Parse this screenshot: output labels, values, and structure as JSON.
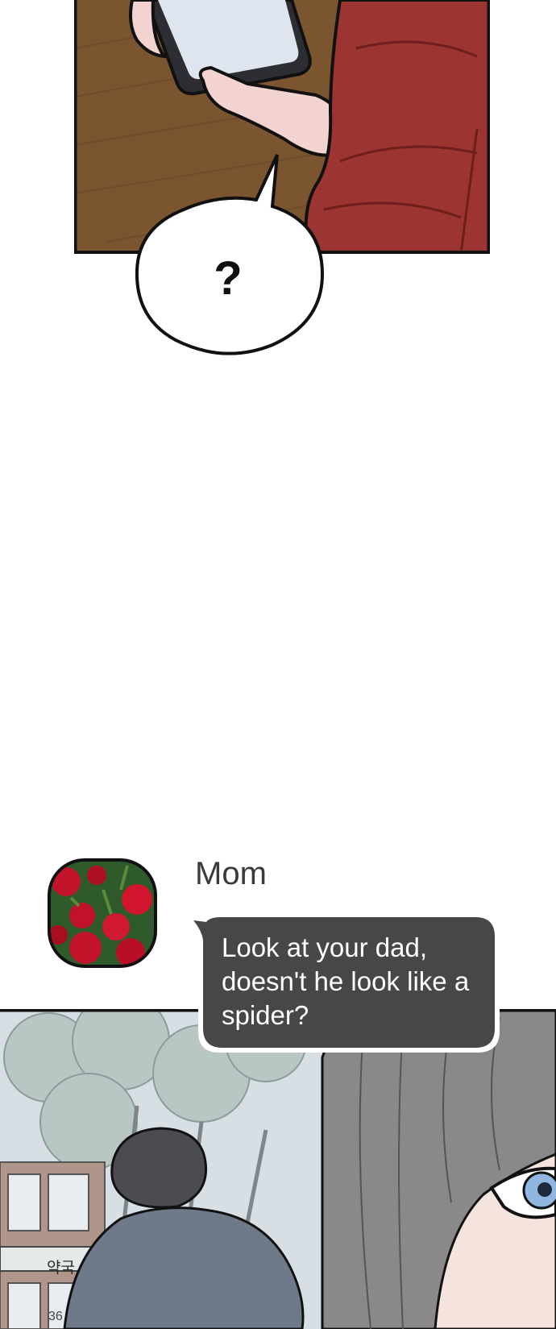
{
  "speech_bubble": {
    "text": "?"
  },
  "chat": {
    "sender": "Mom",
    "message": "Look at your dad, doesn't he look like a spider?"
  },
  "background": {
    "sign_text": "약국",
    "number_text": "36"
  },
  "colors": {
    "message_bubble": "#474747",
    "message_text": "#ffffff",
    "hoodie_red": "#9c3431",
    "floor_wood": "#7a5530",
    "panel_border": "#111111",
    "sky_wash": "#d7dfe4",
    "hair_gray": "#8a8888",
    "eye_blue": "#8fb7df"
  },
  "icons": [
    "rose-avatar-icon",
    "phone-icon"
  ]
}
